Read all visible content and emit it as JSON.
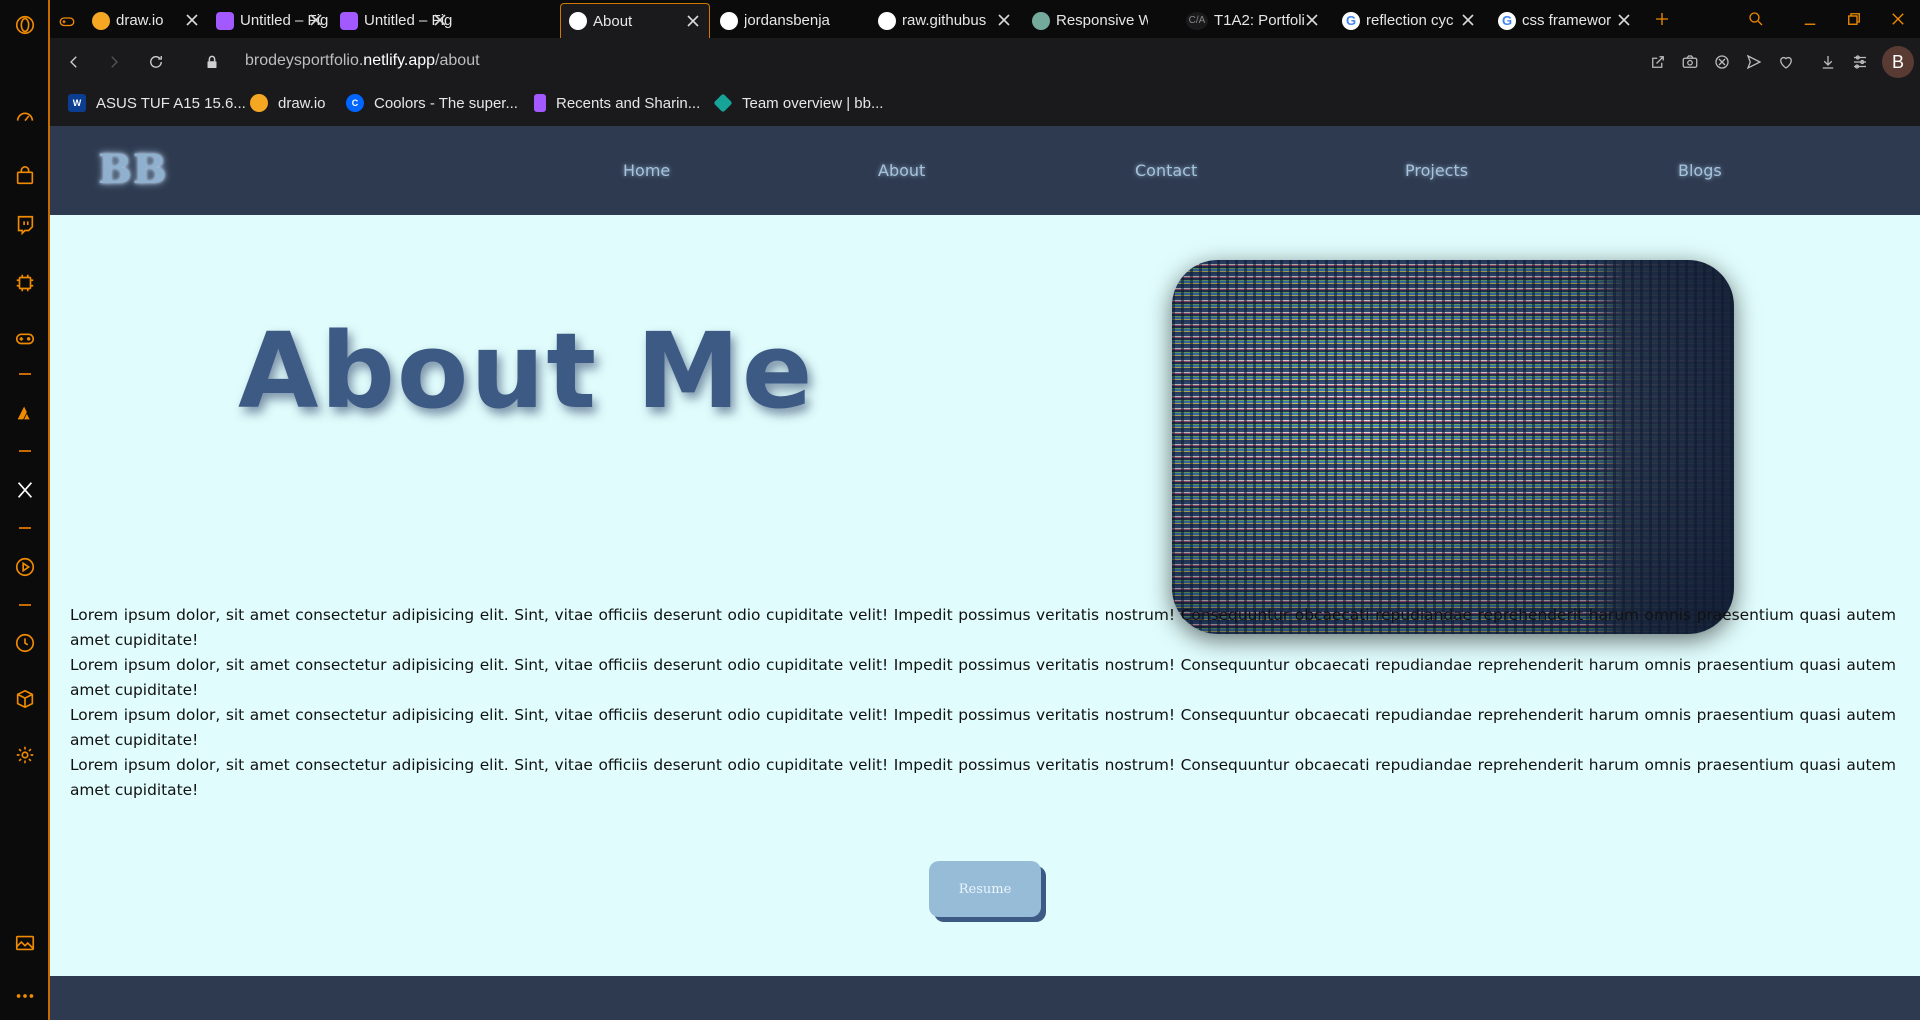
{
  "browser": {
    "tabs": [
      {
        "label": "",
        "icon": "gamepad-icon",
        "color": "#f08a00"
      },
      {
        "label": "draw.io",
        "icon": "drawio-icon",
        "color": "#f5a623"
      },
      {
        "label": "Untitled – Fig",
        "icon": "figma-icon",
        "color": "#a259ff"
      },
      {
        "label": "Untitled – Fig",
        "icon": "figma-icon",
        "color": "#a259ff"
      },
      {
        "label": "About",
        "icon": "globe-icon",
        "color": "#ffffff",
        "active": true
      },
      {
        "label": "jordansbenja",
        "icon": "github-icon",
        "color": "#ffffff"
      },
      {
        "label": "raw.githubus",
        "icon": "globe-icon",
        "color": "#ffffff"
      },
      {
        "label": "Responsive W",
        "icon": "chatgpt-icon",
        "color": "#74aa9c"
      },
      {
        "label": "T1A2: Portfoli",
        "icon": "canvas-icon",
        "color": "#888888"
      },
      {
        "label": "reflection cyc",
        "icon": "google-icon",
        "color": "#4285f4"
      },
      {
        "label": "css framewor",
        "icon": "google-icon",
        "color": "#4285f4"
      }
    ],
    "url": {
      "prefix": "brodeysportfolio.",
      "host": "netlify.app",
      "path": "/about"
    },
    "profile_initial": "B",
    "bookmarks": [
      {
        "label": "ASUS TUF A15 15.6...",
        "icon": "asus-icon",
        "color": "#0b3d91"
      },
      {
        "label": "draw.io",
        "icon": "drawio-icon",
        "color": "#f5a623"
      },
      {
        "label": "Coolors - The super...",
        "icon": "coolors-icon",
        "color": "#0066ff"
      },
      {
        "label": "Recents and Sharin...",
        "icon": "figma-icon",
        "color": "#a259ff"
      },
      {
        "label": "Team overview | bb...",
        "icon": "bitbucket-icon",
        "color": "#17a398"
      }
    ]
  },
  "site": {
    "logo": "BB",
    "nav": [
      "Home",
      "About",
      "Contact",
      "Projects",
      "Blogs"
    ],
    "title": "About Me",
    "paragraphs": [
      "Lorem ipsum dolor, sit amet consectetur adipisicing elit. Sint, vitae officiis deserunt odio cupiditate velit! Impedit possimus veritatis nostrum! Consequuntur obcaecati repudiandae reprehenderit harum omnis praesentium quasi autem amet cupiditate!",
      "Lorem ipsum dolor, sit amet consectetur adipisicing elit. Sint, vitae officiis deserunt odio cupiditate velit! Impedit possimus veritatis nostrum! Consequuntur obcaecati repudiandae reprehenderit harum omnis praesentium quasi autem amet cupiditate!",
      "Lorem ipsum dolor, sit amet consectetur adipisicing elit. Sint, vitae officiis deserunt odio cupiditate velit! Impedit possimus veritatis nostrum! Consequuntur obcaecati repudiandae reprehenderit harum omnis praesentium quasi autem amet cupiditate!",
      "Lorem ipsum dolor, sit amet consectetur adipisicing elit. Sint, vitae officiis deserunt odio cupiditate velit! Impedit possimus veritatis nostrum! Consequuntur obcaecati repudiandae reprehenderit harum omnis praesentium quasi autem amet cupiditate!"
    ],
    "resume_label": "Resume",
    "colors": {
      "nav_bg": "#2e3a4f",
      "page_bg": "#e0fcfc",
      "title": "#3d5a85",
      "button": "#97bcd8",
      "accent": "#f08a00"
    }
  }
}
